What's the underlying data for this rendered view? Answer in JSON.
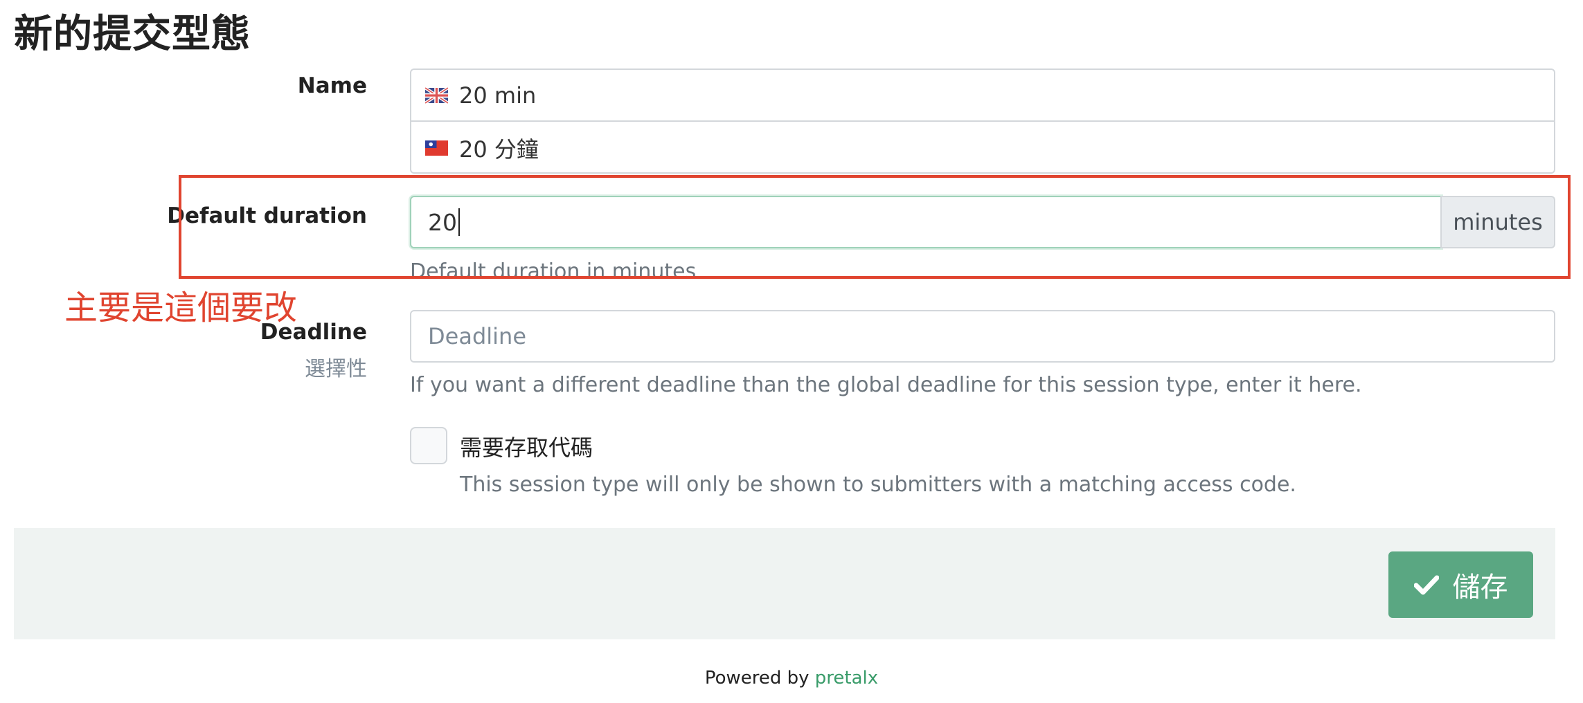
{
  "page": {
    "title": "新的提交型態"
  },
  "form": {
    "name": {
      "label": "Name",
      "translations": [
        {
          "flag": "gb-flag-icon",
          "value": "20 min"
        },
        {
          "flag": "tw-flag-icon",
          "value": "20 分鐘"
        }
      ]
    },
    "default_duration": {
      "label": "Default duration",
      "value": "20",
      "addon": "minutes",
      "help": "Default duration in minutes"
    },
    "deadline": {
      "label": "Deadline",
      "optional": "選擇性",
      "placeholder": "Deadline",
      "value": "",
      "help": "If you want a different deadline than the global deadline for this session type, enter it here."
    },
    "requires_access_code": {
      "label": "需要存取代碼",
      "checked": false,
      "help": "This session type will only be shown to submitters with a matching access code."
    },
    "submit": {
      "label": "儲存",
      "icon": "check-icon"
    }
  },
  "annotation": {
    "text": "主要是這個要改",
    "color": "#e0442f"
  },
  "footer": {
    "prefix": "Powered by",
    "link": "pretalx"
  },
  "colors": {
    "accent": "#5aa782",
    "focus_border": "#9fd2b9",
    "muted": "#6c757d"
  }
}
